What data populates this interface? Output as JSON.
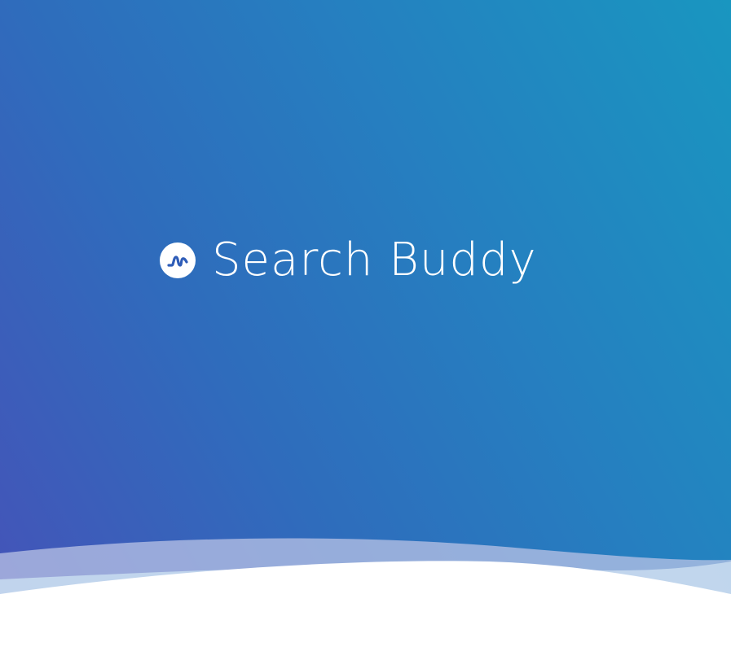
{
  "app": {
    "title": "Search Buddy",
    "logo_icon": "wave-logo-icon"
  },
  "colors": {
    "gradient_start": "#4652b8",
    "gradient_mid": "#2580c0",
    "gradient_end": "#1996c0",
    "logo_mark": "#2f5db8",
    "text": "#ffffff"
  }
}
